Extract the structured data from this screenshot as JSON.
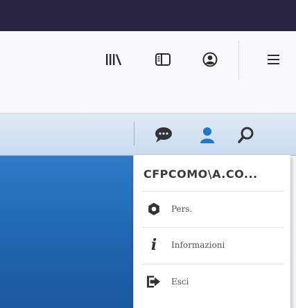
{
  "browser_toolbar": {
    "icons": [
      "library-icon",
      "sidebar-icon",
      "account-icon",
      "hamburger-menu-icon"
    ]
  },
  "app_bar": {
    "icons": [
      "chat-icon",
      "user-icon",
      "search-icon"
    ],
    "colors": {
      "chat": "#333333",
      "user": "#1f78c8",
      "search": "#333333"
    }
  },
  "user_menu": {
    "username": "CFPCOMO\\A.CO...",
    "items": [
      {
        "label": "Pers.",
        "icon": "gear-icon"
      },
      {
        "label": "Informazioni",
        "icon": "info-icon"
      },
      {
        "label": "Esci",
        "icon": "logout-icon"
      }
    ]
  },
  "colors": {
    "title_bar": "#25233f",
    "content_blue": "#1e63ad",
    "app_bar": "#d3e3f4"
  }
}
